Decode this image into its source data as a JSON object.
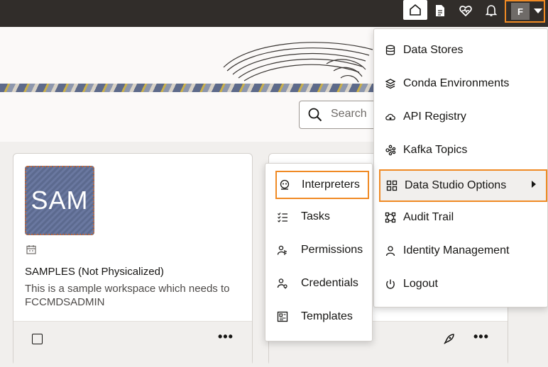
{
  "header": {
    "user_initial": "F",
    "icons": [
      "home-icon",
      "document-icon",
      "health-icon",
      "bell-icon",
      "user-menu-caret-icon"
    ]
  },
  "search": {
    "placeholder": "Search"
  },
  "cards": [
    {
      "thumb_text": "SAM",
      "title": "SAMPLES (Not Physicalized)",
      "description": "This is a sample workspace which needs to",
      "owner": "FCCMDSADMIN"
    }
  ],
  "user_menu": {
    "items": [
      {
        "label": "Data Stores",
        "icon": "database-icon"
      },
      {
        "label": "Conda Environments",
        "icon": "layers-icon"
      },
      {
        "label": "API Registry",
        "icon": "cloud-api-icon"
      },
      {
        "label": "Kafka Topics",
        "icon": "kafka-icon"
      },
      {
        "label": "Data Studio Options",
        "icon": "data-studio-icon",
        "has_submenu": true,
        "highlighted": true
      },
      {
        "label": "Audit Trail",
        "icon": "audit-icon"
      },
      {
        "label": "Identity Management",
        "icon": "person-icon"
      },
      {
        "label": "Logout",
        "icon": "power-icon"
      }
    ]
  },
  "submenu": {
    "items": [
      {
        "label": "Interpreters",
        "icon": "interpreter-icon",
        "highlighted": true
      },
      {
        "label": "Tasks",
        "icon": "tasks-icon"
      },
      {
        "label": "Permissions",
        "icon": "permissions-icon"
      },
      {
        "label": "Credentials",
        "icon": "credentials-icon"
      },
      {
        "label": "Templates",
        "icon": "templates-icon"
      }
    ]
  },
  "colors": {
    "topbar": "#312d2a",
    "highlight": "#f08a24",
    "thumb": "#5c6a8f"
  }
}
